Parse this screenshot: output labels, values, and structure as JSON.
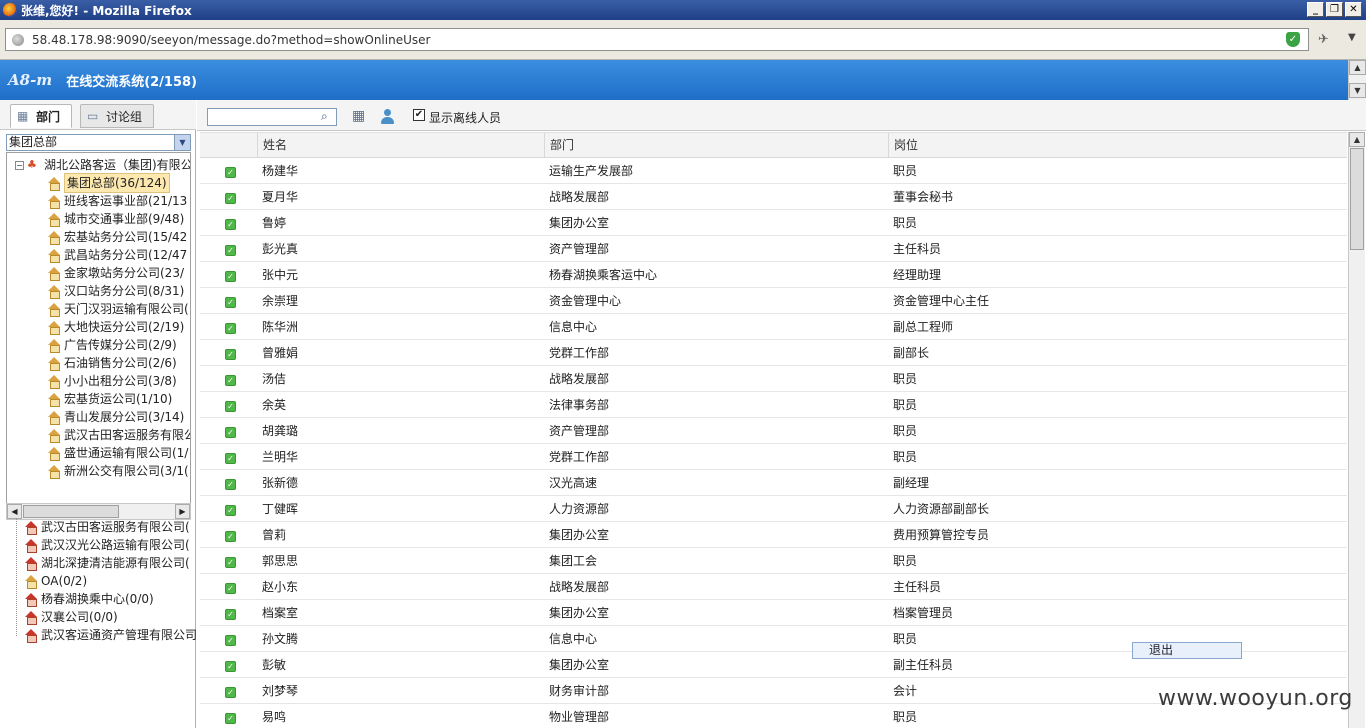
{
  "window": {
    "title": "张维,您好! - Mozilla Firefox",
    "buttons": {
      "minimize": "_",
      "restore": "❐",
      "close": "✕"
    }
  },
  "browser": {
    "url": "58.48.178.98:9090/seeyon/message.do?method=showOnlineUser"
  },
  "app": {
    "logo": "A8-m",
    "title": "在线交流系统(2/158)"
  },
  "left": {
    "tabs": [
      {
        "label": "部门",
        "icon": "building-icon",
        "active": true
      },
      {
        "label": "讨论组",
        "icon": "chat-bubble-icon",
        "active": false
      }
    ],
    "selected_dept": "集团总部",
    "tree_root": "湖北公路客运（集团)有限公",
    "tree_children": [
      {
        "label": "集团总部(36/124)",
        "selected": true
      },
      {
        "label": "班线客运事业部(21/13"
      },
      {
        "label": "城市交通事业部(9/48)"
      },
      {
        "label": "宏基站务分公司(15/42"
      },
      {
        "label": "武昌站务分公司(12/47"
      },
      {
        "label": "金家墩站务分公司(23/"
      },
      {
        "label": "汉口站务分公司(8/31)"
      },
      {
        "label": "天门汉羽运输有限公司("
      },
      {
        "label": "大地快运分公司(2/19)"
      },
      {
        "label": "广告传媒分公司(2/9)"
      },
      {
        "label": "石油销售分公司(2/6)"
      },
      {
        "label": "小小出租分公司(3/8)"
      },
      {
        "label": "宏基货运公司(1/10)"
      },
      {
        "label": "青山发展分公司(3/14)"
      },
      {
        "label": "武汉古田客运服务有限公"
      },
      {
        "label": "盛世通运输有限公司(1/"
      },
      {
        "label": "新洲公交有限公司(3/1("
      }
    ],
    "outer_items": [
      {
        "label": "武汉古田客运服务有限公司(",
        "icon": "red"
      },
      {
        "label": "武汉汉光公路运输有限公司(",
        "icon": "red"
      },
      {
        "label": "湖北深捷清洁能源有限公司(",
        "icon": "red"
      },
      {
        "label": "OA(0/2)",
        "icon": "yellow"
      },
      {
        "label": "杨春湖换乘中心(0/0)",
        "icon": "red"
      },
      {
        "label": "汉襄公司(0/0)",
        "icon": "red"
      },
      {
        "label": "武汉客运通资产管理有限公司",
        "icon": "red"
      }
    ]
  },
  "toolbar": {
    "search_placeholder": "",
    "show_offline_label": "显示离线人员",
    "show_offline_checked": "✔"
  },
  "grid": {
    "headers": {
      "name": "姓名",
      "dept": "部门",
      "position": "岗位"
    },
    "rows": [
      {
        "name": "杨建华",
        "dept": "运输生产发展部",
        "position": "职员"
      },
      {
        "name": "夏月华",
        "dept": "战略发展部",
        "position": "董事会秘书"
      },
      {
        "name": "鲁婷",
        "dept": "集团办公室",
        "position": "职员"
      },
      {
        "name": "彭光真",
        "dept": "资产管理部",
        "position": "主任科员"
      },
      {
        "name": "张中元",
        "dept": "杨春湖换乘客运中心",
        "position": "经理助理"
      },
      {
        "name": "余崇理",
        "dept": "资金管理中心",
        "position": "资金管理中心主任"
      },
      {
        "name": "陈华洲",
        "dept": "信息中心",
        "position": "副总工程师"
      },
      {
        "name": "曾雅娟",
        "dept": "党群工作部",
        "position": "副部长"
      },
      {
        "name": "汤佶",
        "dept": "战略发展部",
        "position": "职员"
      },
      {
        "name": "余英",
        "dept": "法律事务部",
        "position": "职员"
      },
      {
        "name": "胡龚璐",
        "dept": "资产管理部",
        "position": "职员"
      },
      {
        "name": "兰明华",
        "dept": "党群工作部",
        "position": "职员"
      },
      {
        "name": "张新德",
        "dept": "汉光高速",
        "position": "副经理"
      },
      {
        "name": "丁健晖",
        "dept": "人力资源部",
        "position": "人力资源部副部长"
      },
      {
        "name": "曾莉",
        "dept": "集团办公室",
        "position": "费用预算管控专员"
      },
      {
        "name": "郭思思",
        "dept": "集团工会",
        "position": "职员"
      },
      {
        "name": "赵小东",
        "dept": "战略发展部",
        "position": "主任科员"
      },
      {
        "name": "档案室",
        "dept": "集团办公室",
        "position": "档案管理员"
      },
      {
        "name": "孙文腾",
        "dept": "信息中心",
        "position": "职员"
      },
      {
        "name": "彭敏",
        "dept": "集团办公室",
        "position": "副主任科员"
      },
      {
        "name": "刘梦琴",
        "dept": "财务审计部",
        "position": "会计"
      },
      {
        "name": "易鸣",
        "dept": "物业管理部",
        "position": "职员"
      }
    ]
  },
  "exit_label": "退出",
  "watermark": "www.wooyun.org"
}
